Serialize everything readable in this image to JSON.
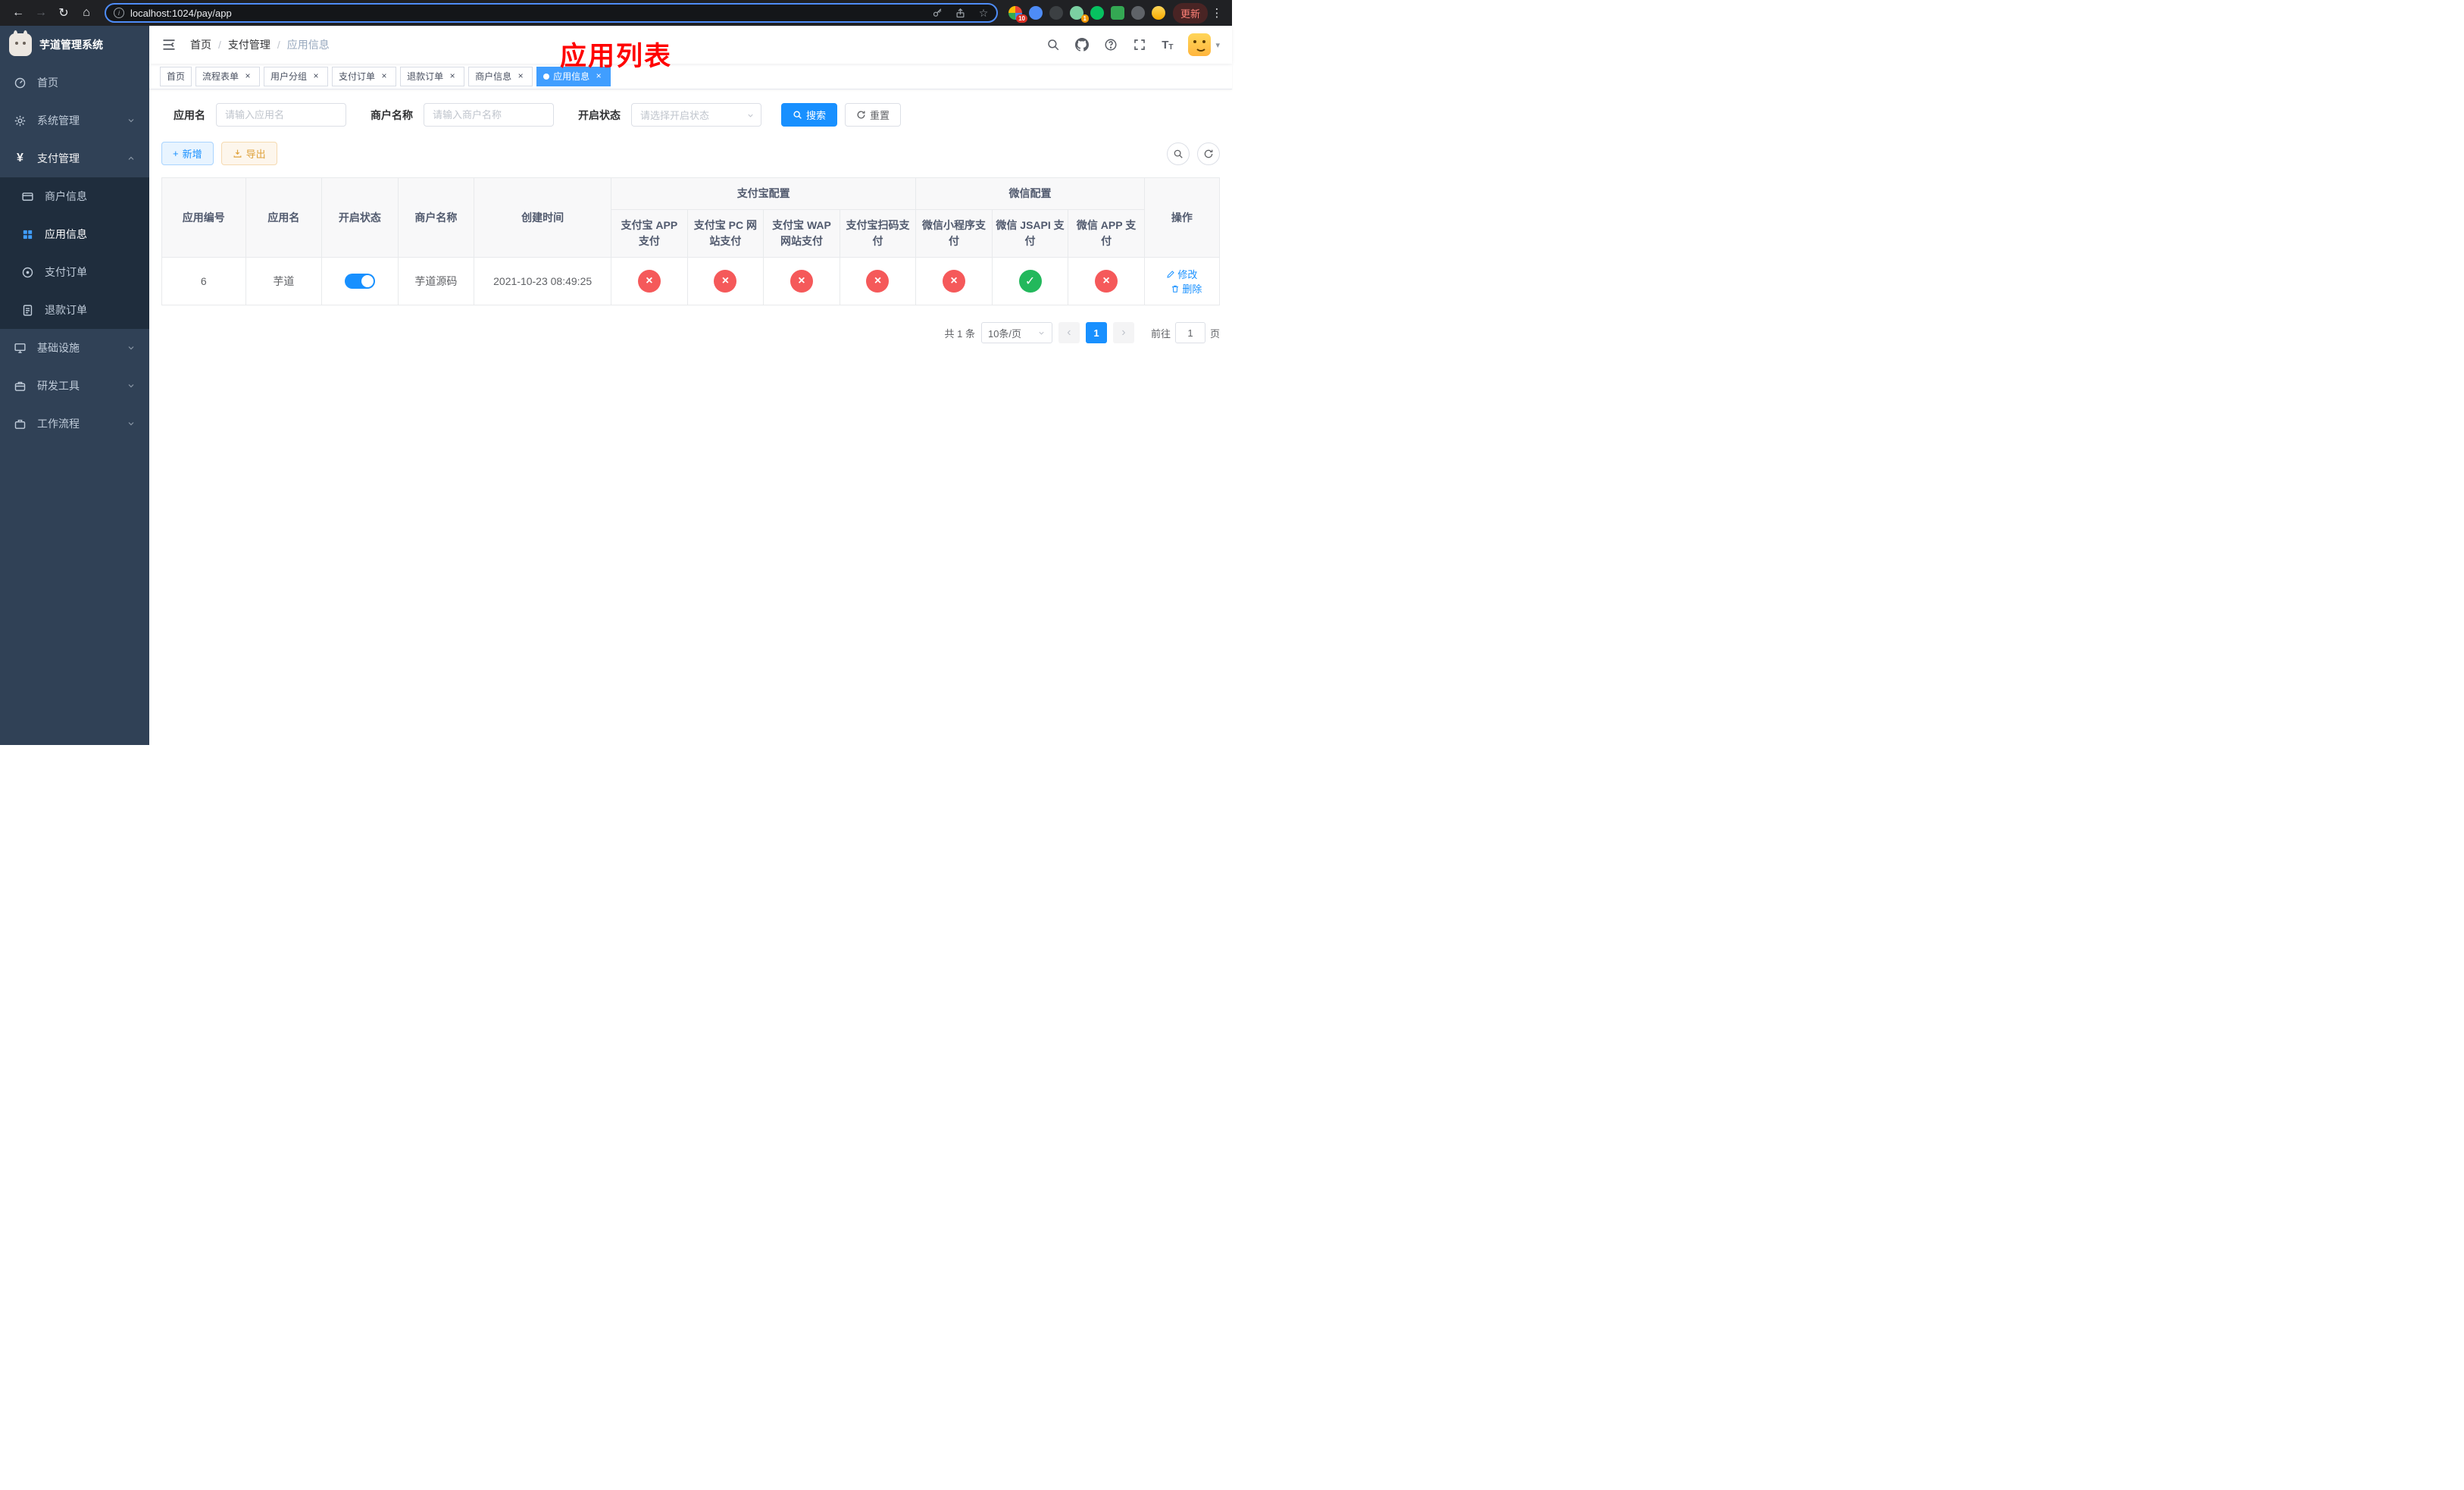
{
  "browser": {
    "url": "localhost:1024/pay/app",
    "update_label": "更新",
    "ext_badge_1": "10",
    "ext_badge_2": "1"
  },
  "icons": {
    "back": "←",
    "forward": "→",
    "reload": "↻",
    "home": "⌂",
    "star": "☆",
    "info": "i",
    "close": "×",
    "plus": "+",
    "yen": "¥",
    "prev": "‹",
    "next": "›",
    "separator": "/",
    "menu_dots": "⋮",
    "font_size_big": "T",
    "font_size_small": "T",
    "check": "✓",
    "cross": "×"
  },
  "theme": {
    "primary": "#1890ff",
    "tag_active": "#409eff",
    "success": "#23b85c",
    "danger": "#f5595a",
    "warning": "#dfa23c",
    "sidebar_bg": "#304156",
    "submenu_bg": "#1f2d3d",
    "overlay_title_color": "#ff0000"
  },
  "sidebar": {
    "title": "芋道管理系统",
    "items": [
      {
        "label": "首页"
      },
      {
        "label": "系统管理"
      },
      {
        "label": "支付管理"
      },
      {
        "label": "基础设施"
      },
      {
        "label": "研发工具"
      },
      {
        "label": "工作流程"
      }
    ],
    "submenu": [
      {
        "label": "商户信息"
      },
      {
        "label": "应用信息"
      },
      {
        "label": "支付订单"
      },
      {
        "label": "退款订单"
      }
    ]
  },
  "header": {
    "breadcrumb": [
      "首页",
      "支付管理",
      "应用信息"
    ],
    "overlay_title": "应用列表"
  },
  "tabs": [
    {
      "label": "首页"
    },
    {
      "label": "流程表单"
    },
    {
      "label": "用户分组"
    },
    {
      "label": "支付订单"
    },
    {
      "label": "退款订单"
    },
    {
      "label": "商户信息"
    },
    {
      "label": "应用信息"
    }
  ],
  "filters": {
    "app_name_label": "应用名",
    "app_name_placeholder": "请输入应用名",
    "merchant_label": "商户名称",
    "merchant_placeholder": "请输入商户名称",
    "status_label": "开启状态",
    "status_placeholder": "请选择开启状态",
    "search_label": "搜索",
    "reset_label": "重置"
  },
  "toolbar": {
    "add_label": "新增",
    "export_label": "导出"
  },
  "table": {
    "groups": {
      "alipay": "支付宝配置",
      "wechat": "微信配置"
    },
    "cols": {
      "id": "应用编号",
      "name": "应用名",
      "status": "开启状态",
      "merchant": "商户名称",
      "created": "创建时间",
      "alipay_app": "支付宝 APP 支付",
      "alipay_pc": "支付宝 PC 网站支付",
      "alipay_wap": "支付宝 WAP 网站支付",
      "alipay_qr": "支付宝扫码支付",
      "wx_mini": "微信小程序支付",
      "wx_jsapi": "微信 JSAPI 支付",
      "wx_app": "微信 APP 支付",
      "action": "操作"
    },
    "rows": [
      {
        "id": "6",
        "name": "芋道",
        "status_on": true,
        "merchant": "芋道源码",
        "created": "2021-10-23 08:49:25",
        "configs": [
          "no",
          "no",
          "no",
          "no",
          "no",
          "yes",
          "no"
        ],
        "edit_label": "修改",
        "delete_label": "删除"
      }
    ]
  },
  "pagination": {
    "total": "共 1 条",
    "page_size": "10条/页",
    "page": "1",
    "goto_label": "前往",
    "goto_value": "1",
    "unit": "页"
  }
}
